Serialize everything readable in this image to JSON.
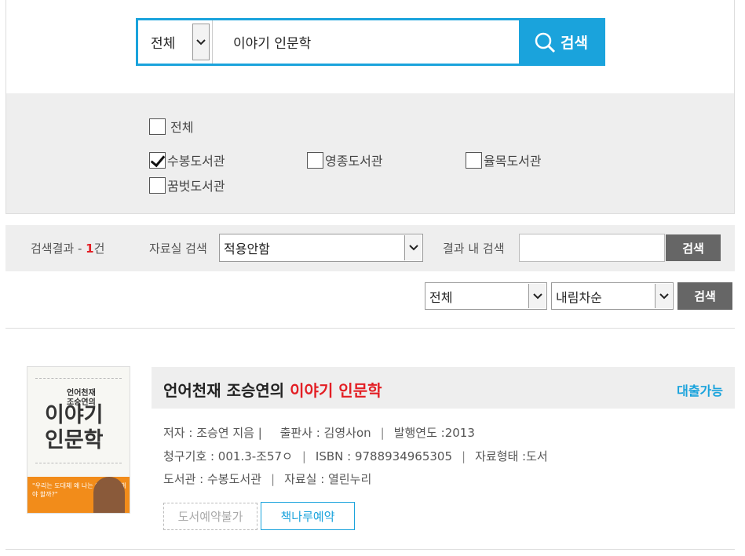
{
  "search": {
    "scope_value": "전체",
    "query_value": "이야기 인문학",
    "button_label": "검색"
  },
  "libraries": {
    "all_label": "전체",
    "items": [
      {
        "label": "수봉도서관",
        "checked": true
      },
      {
        "label": "영종도서관",
        "checked": false
      },
      {
        "label": "율목도서관",
        "checked": false
      },
      {
        "label": "꿈벗도서관",
        "checked": false
      }
    ]
  },
  "results_bar": {
    "count_prefix": "검색결과 - ",
    "count": "1",
    "count_suffix": "건",
    "room_search_label": "자료실 검색",
    "room_select_value": "적용안함",
    "within_search_label": "결과 내 검색",
    "within_search_value": "",
    "within_search_button": "검색"
  },
  "sort": {
    "field_value": "전체",
    "order_value": "내림차순",
    "button_label": "검색"
  },
  "result": {
    "title_prefix": "언어천재 조승연의 ",
    "title_highlight": "이야기 인문학",
    "availability": "대출가능",
    "author": "저자 : 조승연 지음 |",
    "publisher": "출판사 : 김영사on",
    "year": "발행연도 :2013",
    "call_number": "청구기호 : 001.3-조57ㅇ",
    "isbn": "ISBN : 9788934965305",
    "material_type": "자료형태 :도서",
    "library": "도서관 : 수봉도서관",
    "room": "자료실 : 열린누리",
    "reserve_disabled": "도서예약불가",
    "reserve_chaeknaru": "책나루예약",
    "cover": {
      "small_title_1": "언어천재",
      "small_title_2": "조승연의",
      "big_title_1": "이야기",
      "big_title_2": "인문학",
      "band_text": "\"우리는 도대체 왜 나는 인문학을 해야 할까?\""
    }
  },
  "colors": {
    "accent": "#1aa3dc",
    "highlight": "#e31e24",
    "button_gray": "#666666",
    "panel_gray": "#eeeeee"
  }
}
